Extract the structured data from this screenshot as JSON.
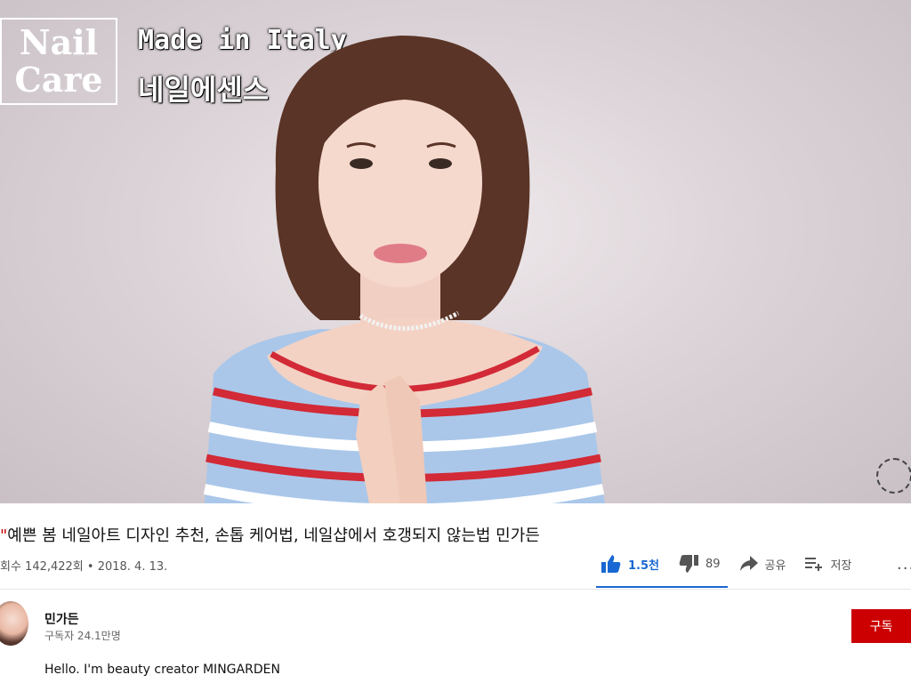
{
  "video": {
    "overlay_box_line1": "Nail",
    "overlay_box_line2": "Care",
    "overlay_caption_en": "Made in Italy",
    "overlay_caption_ko": "네일에센스"
  },
  "title": {
    "mark": "\"",
    "text": "예쁜 봄 네일아트 디자인 추천, 손톱 케어법, 네일샵에서 호갱되지 않는법 민가든"
  },
  "meta": {
    "views_date": "회수 142,422회 • 2018. 4. 13."
  },
  "actions": {
    "like_count": "1.5천",
    "dislike_count": "89",
    "share_label": "공유",
    "save_label": "저장",
    "more_label": "..."
  },
  "channel": {
    "name": "민가든",
    "subscribers": "구독자 24.1만명",
    "subscribe_label": "구독"
  },
  "description": {
    "first_line": "Hello. I'm beauty creator MINGARDEN"
  },
  "colors": {
    "accent_blue": "#1967d2",
    "subscribe_red": "#cc0000"
  }
}
